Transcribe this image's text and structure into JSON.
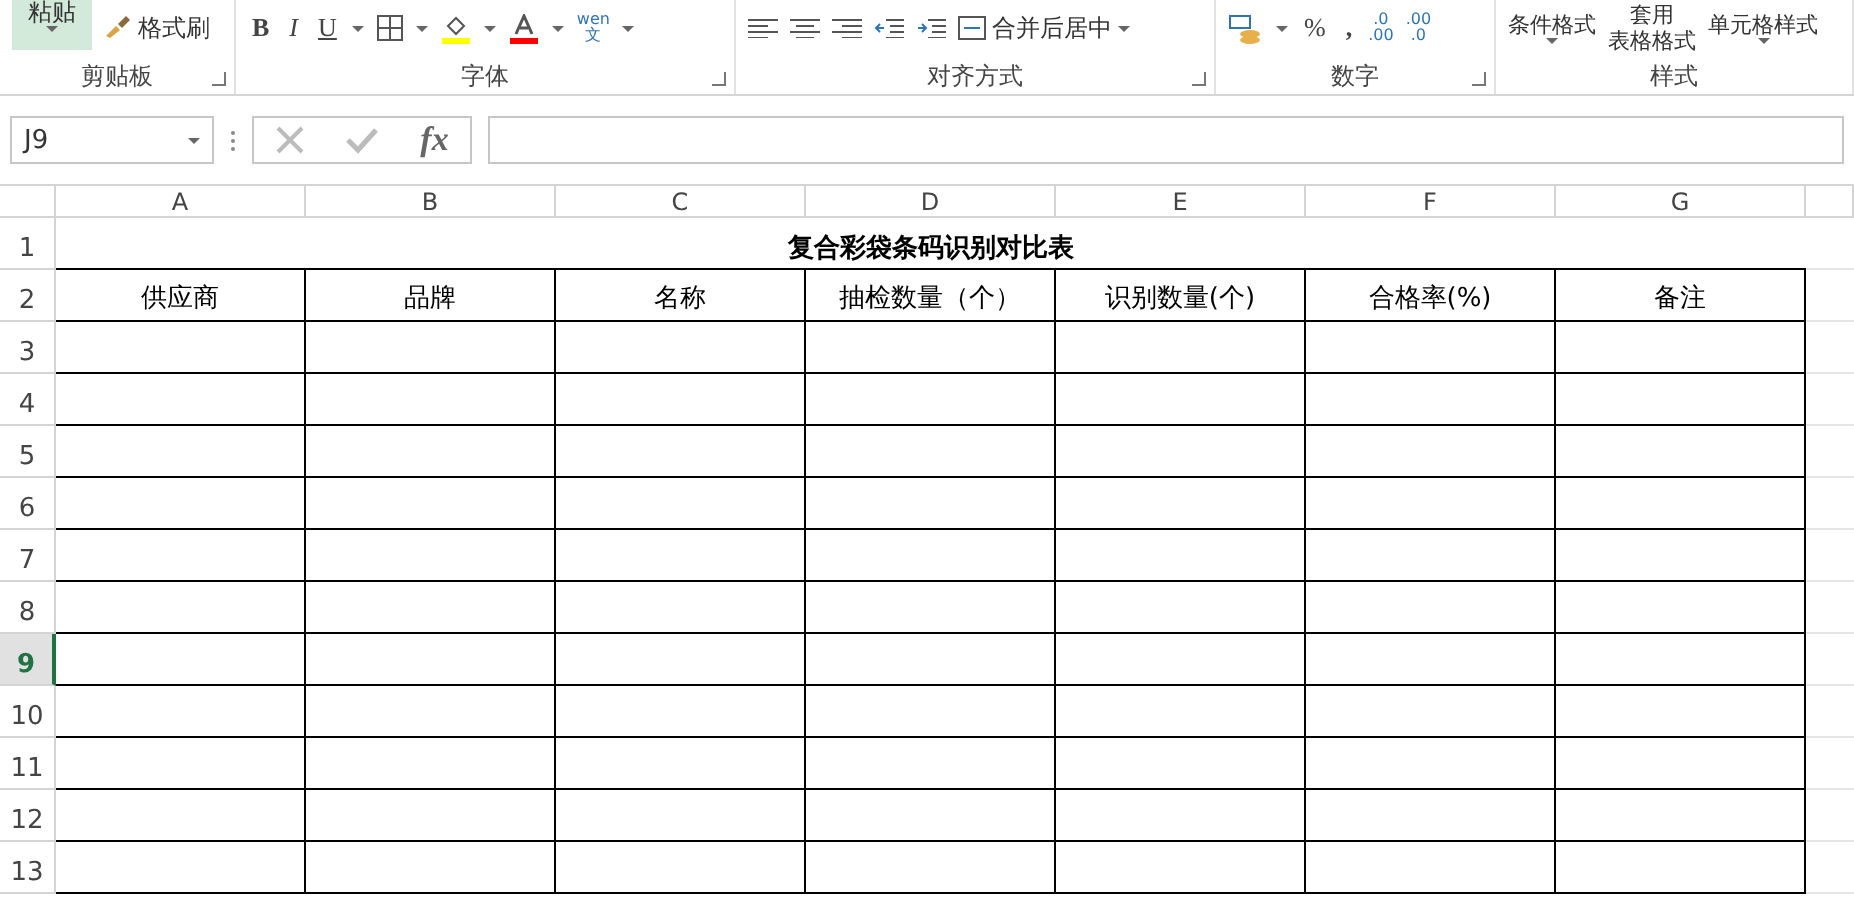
{
  "ribbon": {
    "clipboard": {
      "paste": "粘贴",
      "format_painter": "格式刷",
      "label": "剪贴板"
    },
    "font": {
      "bold": "B",
      "italic": "I",
      "underline": "U",
      "phonetic": [
        "wen",
        "文"
      ],
      "label": "字体"
    },
    "alignment": {
      "merge": "合并后居中",
      "label": "对齐方式"
    },
    "number": {
      "percent": "%",
      "comma": ",",
      "increase_decimal": [
        ".0",
        ".00"
      ],
      "decrease_decimal": [
        ".00",
        ".0"
      ],
      "label": "数字"
    },
    "styles": {
      "conditional": "条件格式",
      "table_format": [
        "套用",
        "表格格式"
      ],
      "cell_styles": "单元格样式",
      "label": "样式"
    }
  },
  "formula_bar": {
    "name_box": "J9",
    "function": "fx"
  },
  "sheet": {
    "columns": [
      "A",
      "B",
      "C",
      "D",
      "E",
      "F",
      "G"
    ],
    "rows": [
      {
        "label": "1",
        "selected": false
      },
      {
        "label": "2",
        "selected": false
      },
      {
        "label": "3",
        "selected": false
      },
      {
        "label": "4",
        "selected": false
      },
      {
        "label": "5",
        "selected": false
      },
      {
        "label": "6",
        "selected": false
      },
      {
        "label": "7",
        "selected": false
      },
      {
        "label": "8",
        "selected": false
      },
      {
        "label": "9",
        "selected": true
      },
      {
        "label": "10",
        "selected": false
      },
      {
        "label": "11",
        "selected": false
      },
      {
        "label": "12",
        "selected": false
      },
      {
        "label": "13",
        "selected": false
      }
    ],
    "title": "复合彩袋条码识别对比表",
    "headers": [
      "供应商",
      "品牌",
      "名称",
      "抽检数量（个）",
      "识别数量(个)",
      "合格率(%)",
      "备注"
    ]
  }
}
